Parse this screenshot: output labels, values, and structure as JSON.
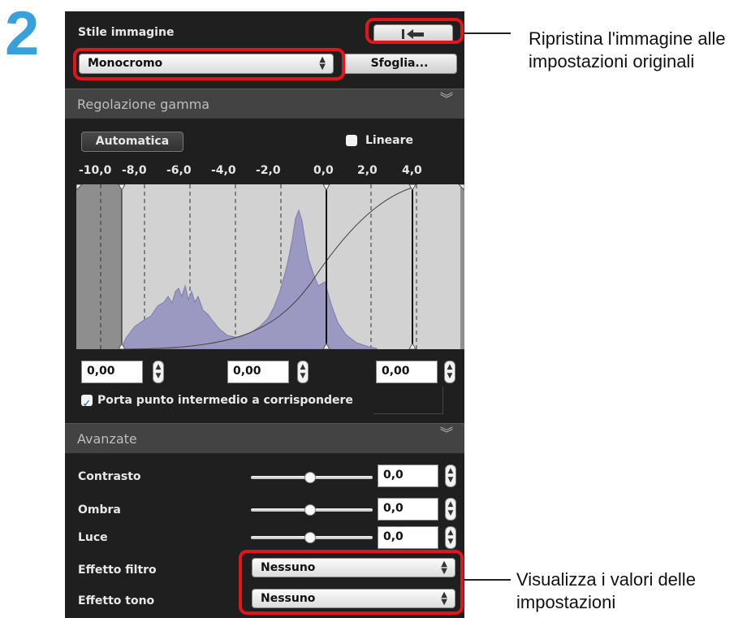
{
  "step_number": "2",
  "picture_style": {
    "label": "Stile immagine",
    "reset_icon": "reset-arrow-icon",
    "selected": "Monocromo",
    "browse_label": "Sfoglia..."
  },
  "gamma": {
    "section_title": "Regolazione gamma",
    "auto_label": "Automatica",
    "linear_label": "Lineare",
    "linear_checked": false,
    "ticks": [
      "-10,0",
      "-8,0",
      "-6,0",
      "-4,0",
      "-2,0",
      "0,0",
      "2,0",
      "4,0"
    ],
    "inputs": [
      "0,00",
      "0,00",
      "0,00"
    ],
    "midpoint_label": "Porta punto intermedio a corrispondere",
    "midpoint_checked": true
  },
  "advanced": {
    "section_title": "Avanzate",
    "rows": [
      {
        "label": "Contrasto",
        "value": "0,0",
        "level": 0.5
      },
      {
        "label": "Ombra",
        "value": "0,0",
        "level": 0.5
      },
      {
        "label": "Luce",
        "value": "0,0",
        "level": 0.5
      }
    ],
    "filter_label": "Effetto filtro",
    "filter_value": "Nessuno",
    "tone_label": "Effetto tono",
    "tone_value": "Nessuno"
  },
  "callouts": {
    "reset": "Ripristina l'immagine alle impostazioni originali",
    "values": "Visualizza i valori delle impostazioni"
  },
  "colors": {
    "highlight": "#e5141b",
    "step": "#3aa0dc",
    "histogram": "#9b98c2"
  }
}
